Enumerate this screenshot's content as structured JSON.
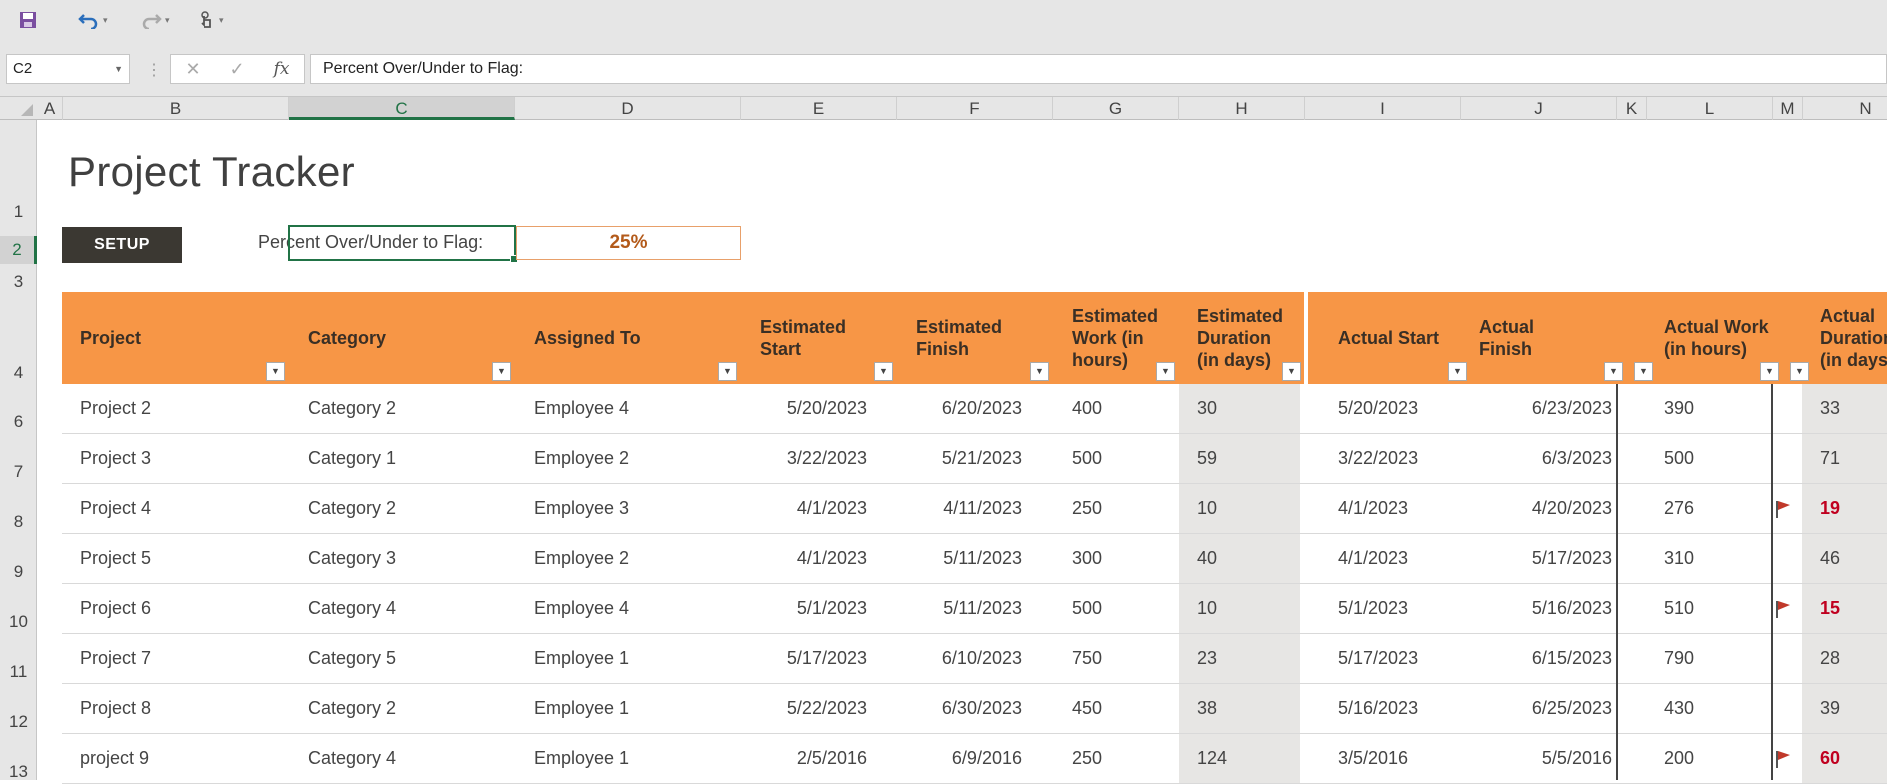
{
  "toolbar": {
    "save_icon": "save-icon",
    "undo_icon": "undo-icon",
    "redo_icon": "redo-icon",
    "touch_icon": "touch-mode-icon"
  },
  "formula_bar": {
    "name_box": "C2",
    "cancel": "✕",
    "enter": "✓",
    "fx": "fx",
    "formula": "Percent Over/Under to Flag:"
  },
  "columns": [
    "A",
    "B",
    "C",
    "D",
    "E",
    "F",
    "G",
    "H",
    "I",
    "J",
    "K",
    "L",
    "M",
    "N"
  ],
  "selected_column": "C",
  "selected_row": "2",
  "sheet": {
    "title": "Project Tracker",
    "setup_button": "SETUP",
    "flag_label": "Percent Over/Under to Flag:",
    "flag_value": "25%"
  },
  "table": {
    "headers": {
      "project": "Project",
      "category": "Category",
      "assigned": "Assigned To",
      "est_start": "Estimated Start",
      "est_finish": "Estimated Finish",
      "est_work": "Estimated Work (in hours)",
      "est_duration": "Estimated Duration (in days)",
      "act_start": "Actual Start",
      "act_finish": "Actual Finish",
      "act_work": "Actual Work (in hours)",
      "act_duration": "Actual Duration (in days)"
    },
    "rows": [
      {
        "num": "6",
        "project": "Project 2",
        "category": "Category 2",
        "assigned": "Employee 4",
        "est_start": "5/20/2023",
        "est_finish": "6/20/2023",
        "est_work": "400",
        "est_duration": "30",
        "act_start": "5/20/2023",
        "act_finish": "6/23/2023",
        "act_work": "390",
        "act_duration": "33",
        "flagged": false
      },
      {
        "num": "7",
        "project": "Project 3",
        "category": "Category 1",
        "assigned": "Employee 2",
        "est_start": "3/22/2023",
        "est_finish": "5/21/2023",
        "est_work": "500",
        "est_duration": "59",
        "act_start": "3/22/2023",
        "act_finish": "6/3/2023",
        "act_work": "500",
        "act_duration": "71",
        "flagged": false
      },
      {
        "num": "8",
        "project": "Project 4",
        "category": "Category 2",
        "assigned": "Employee 3",
        "est_start": "4/1/2023",
        "est_finish": "4/11/2023",
        "est_work": "250",
        "est_duration": "10",
        "act_start": "4/1/2023",
        "act_finish": "4/20/2023",
        "act_work": "276",
        "act_duration": "19",
        "flagged": true
      },
      {
        "num": "9",
        "project": "Project 5",
        "category": "Category 3",
        "assigned": "Employee 2",
        "est_start": "4/1/2023",
        "est_finish": "5/11/2023",
        "est_work": "300",
        "est_duration": "40",
        "act_start": "4/1/2023",
        "act_finish": "5/17/2023",
        "act_work": "310",
        "act_duration": "46",
        "flagged": false
      },
      {
        "num": "10",
        "project": "Project 6",
        "category": "Category 4",
        "assigned": "Employee 4",
        "est_start": "5/1/2023",
        "est_finish": "5/11/2023",
        "est_work": "500",
        "est_duration": "10",
        "act_start": "5/1/2023",
        "act_finish": "5/16/2023",
        "act_work": "510",
        "act_duration": "15",
        "flagged": true
      },
      {
        "num": "11",
        "project": "Project 7",
        "category": "Category 5",
        "assigned": "Employee 1",
        "est_start": "5/17/2023",
        "est_finish": "6/10/2023",
        "est_work": "750",
        "est_duration": "23",
        "act_start": "5/17/2023",
        "act_finish": "6/15/2023",
        "act_work": "790",
        "act_duration": "28",
        "flagged": false
      },
      {
        "num": "12",
        "project": "Project 8",
        "category": "Category 2",
        "assigned": "Employee 1",
        "est_start": "5/22/2023",
        "est_finish": "6/30/2023",
        "est_work": "450",
        "est_duration": "38",
        "act_start": "5/16/2023",
        "act_finish": "6/25/2023",
        "act_work": "430",
        "act_duration": "39",
        "flagged": false
      },
      {
        "num": "13",
        "project": "project 9",
        "category": "Category 4",
        "assigned": "Employee 1",
        "est_start": "2/5/2016",
        "est_finish": "6/9/2016",
        "est_work": "250",
        "est_duration": "124",
        "act_start": "3/5/2016",
        "act_finish": "5/5/2016",
        "act_work": "200",
        "act_duration": "60",
        "flagged": true
      }
    ]
  },
  "colors": {
    "accent": "#f79646",
    "selection": "#217346",
    "flag": "#c0392b",
    "late_text": "#c0001f"
  }
}
